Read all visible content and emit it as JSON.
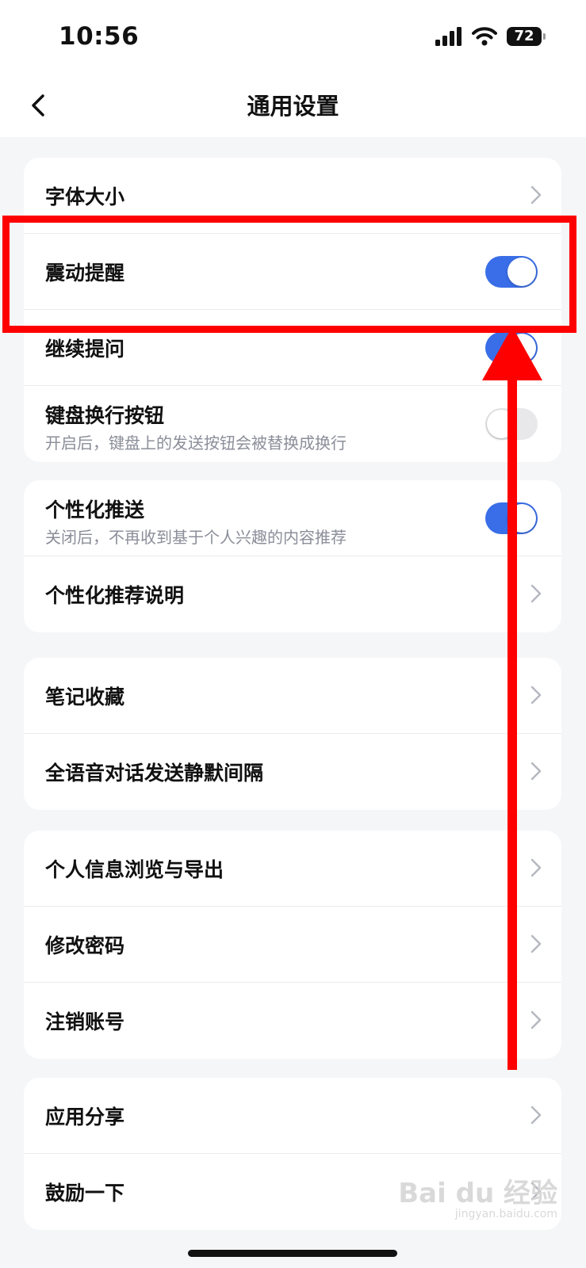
{
  "status_bar": {
    "time": "10:56",
    "battery": "72"
  },
  "header": {
    "title": "通用设置"
  },
  "groups": [
    {
      "items": [
        {
          "label": "字体大小",
          "control": "chevron"
        },
        {
          "label": "震动提醒",
          "control": "toggle",
          "on": true
        },
        {
          "label": "继续提问",
          "control": "toggle",
          "on": true
        },
        {
          "label": "键盘换行按钮",
          "sub": "开启后，键盘上的发送按钮会被替换成换行",
          "control": "toggle",
          "on": false
        }
      ]
    },
    {
      "items": [
        {
          "label": "个性化推送",
          "sub": "关闭后，不再收到基于个人兴趣的内容推荐",
          "control": "toggle",
          "on": true
        },
        {
          "label": "个性化推荐说明",
          "control": "chevron"
        }
      ]
    },
    {
      "items": [
        {
          "label": "笔记收藏",
          "control": "chevron"
        },
        {
          "label": "全语音对话发送静默间隔",
          "control": "chevron"
        }
      ]
    },
    {
      "items": [
        {
          "label": "个人信息浏览与导出",
          "control": "chevron"
        },
        {
          "label": "修改密码",
          "control": "chevron"
        },
        {
          "label": "注销账号",
          "control": "chevron"
        }
      ]
    },
    {
      "items": [
        {
          "label": "应用分享",
          "control": "chevron"
        },
        {
          "label": "鼓励一下",
          "control": "chevron"
        }
      ]
    }
  ],
  "annotation": {
    "color": "#ff0000"
  },
  "colors": {
    "accent": "#3a6ee8",
    "background": "#f5f6f8"
  },
  "watermark": {
    "text": "Bai du 经验",
    "sub": "jingyan.baidu.com"
  }
}
